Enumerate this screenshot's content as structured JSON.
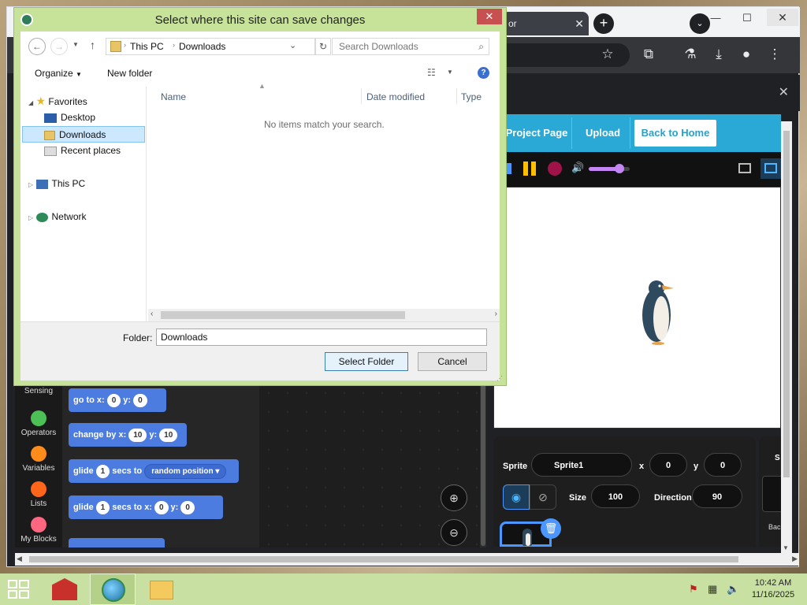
{
  "browser": {
    "tab_title": "or",
    "new_tab": "+",
    "tab_menu": "⌄",
    "minimize": "—",
    "maximize": "☐",
    "close": "✕",
    "overlay_close": "✕"
  },
  "scratch": {
    "project_page": "Project Page",
    "upload": "Upload",
    "back_home": "Back to Home",
    "sprite_label": "Sprite",
    "sprite_name": "Sprite1",
    "x_label": "x",
    "x_value": "0",
    "y_label": "y",
    "y_value": "0",
    "size_label": "Size",
    "size_value": "100",
    "direction_label": "Direction",
    "direction_value": "90",
    "stage_tab_partial": "S",
    "backdrops_partial": "Bac",
    "volume_fraction": 0.75,
    "categories": [
      {
        "label": "Sensing",
        "color": ""
      },
      {
        "label": "Operators",
        "color": "#4cbf56"
      },
      {
        "label": "Variables",
        "color": "#ff8c1a"
      },
      {
        "label": "Lists",
        "color": "#ff661a"
      },
      {
        "label": "My Blocks",
        "color": "#ff6680"
      }
    ],
    "blocks": {
      "goto": {
        "text": "go to x:",
        "x": "0",
        "y_lbl": "y:",
        "y": "0"
      },
      "changeby": {
        "text": "change by x:",
        "x": "10",
        "y_lbl": "y:",
        "y": "10"
      },
      "glide_random": {
        "text": "glide",
        "secs": "1",
        "secs_lbl": "secs to",
        "target": "random position"
      },
      "glide_xy": {
        "text": "glide",
        "secs": "1",
        "secs_lbl": "secs to x:",
        "x": "0",
        "y_lbl": "y:",
        "y": "0"
      }
    }
  },
  "dialog": {
    "title": "Select where this site can save changes",
    "close": "✕",
    "breadcrumb": [
      "This PC",
      "Downloads"
    ],
    "search_placeholder": "Search Downloads",
    "organize": "Organize",
    "new_folder": "New folder",
    "tree": {
      "favorites": "Favorites",
      "desktop": "Desktop",
      "downloads": "Downloads",
      "recent": "Recent places",
      "this_pc": "This PC",
      "network": "Network"
    },
    "columns": {
      "name": "Name",
      "date": "Date modified",
      "type": "Type"
    },
    "empty_message": "No items match your search.",
    "folder_label": "Folder:",
    "folder_value": "Downloads",
    "select_button": "Select Folder",
    "cancel_button": "Cancel"
  },
  "taskbar": {
    "time": "10:42 AM",
    "date": "11/16/2025"
  }
}
